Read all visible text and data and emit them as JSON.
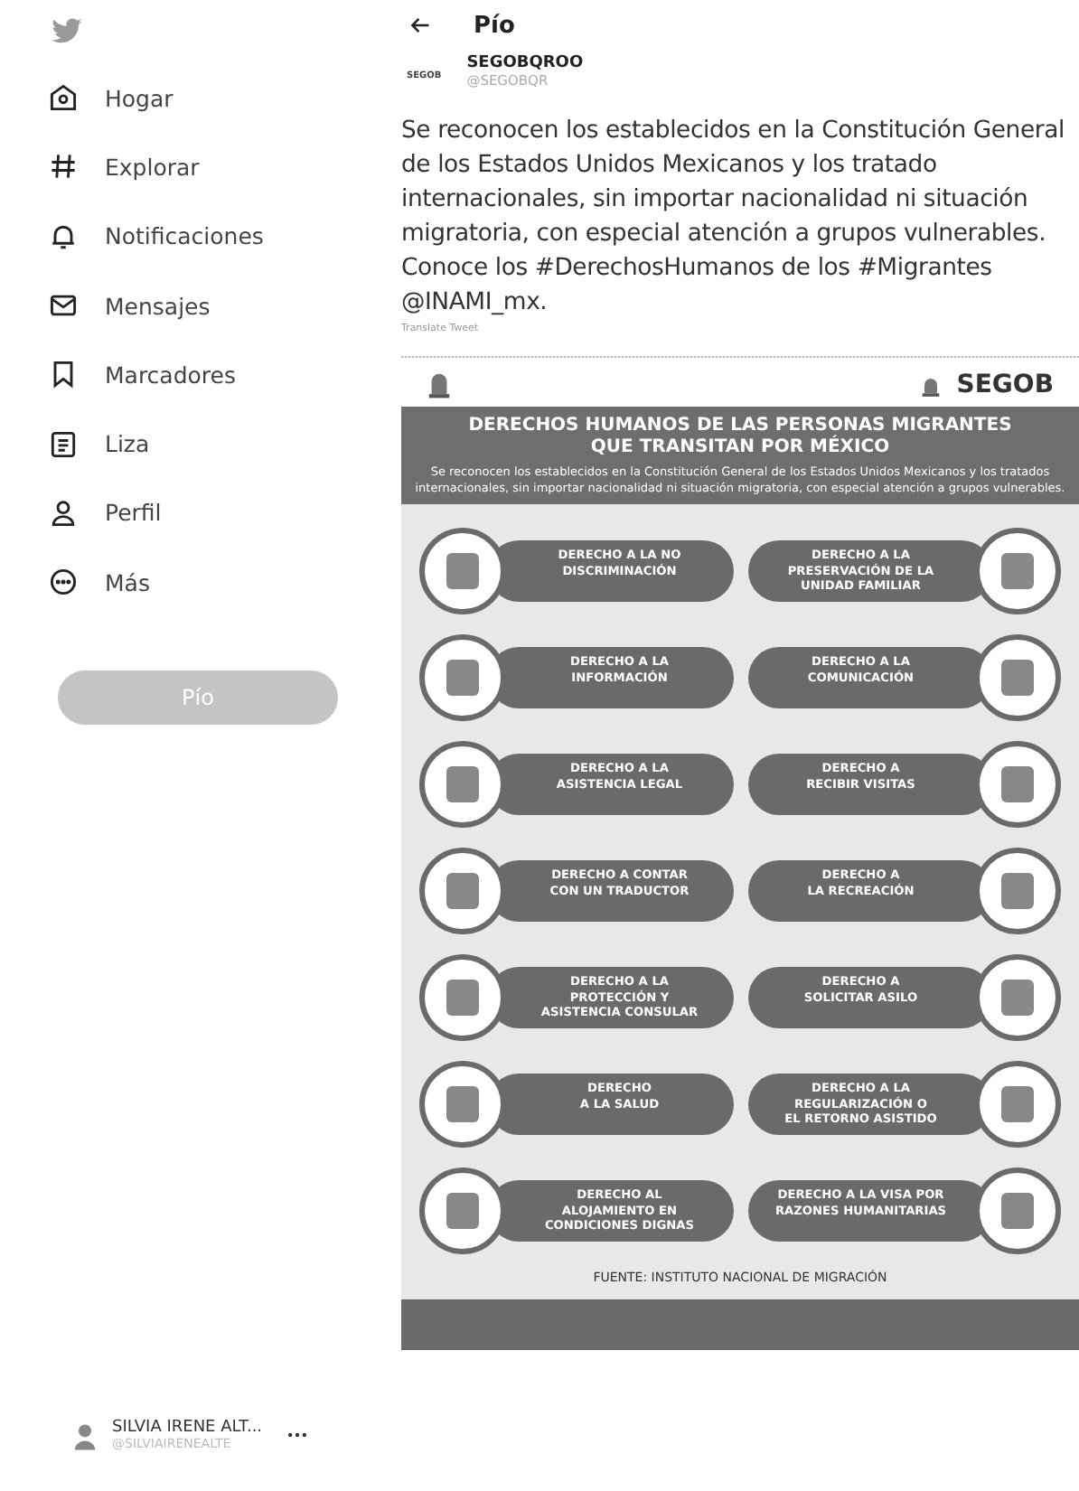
{
  "sidebar": {
    "nav": [
      {
        "label": "Hogar"
      },
      {
        "label": "Explorar"
      },
      {
        "label": "Notificaciones"
      },
      {
        "label": "Mensajes"
      },
      {
        "label": "Marcadores"
      },
      {
        "label": "Liza"
      },
      {
        "label": "Perfil"
      },
      {
        "label": "Más"
      }
    ],
    "tweet_button": "Pío",
    "account": {
      "name": "SILVIA IRENE ALT...",
      "handle": "@SILVIAIRENEALTE"
    }
  },
  "header": {
    "title": "Pío"
  },
  "tweet": {
    "author": {
      "name": "SEGOBQROO",
      "handle": "@SEGOBQR",
      "avatar_text": "SEGOB"
    },
    "text": "Se reconocen los establecidos en la Constitución General de los Estados Unidos Mexicanos y los tratado internacionales, sin importar nacionalidad ni situación migratoria, con especial atención a grupos vulnerables. Conoce los #DerechosHumanos de los #Migrantes @INAMI_mx.",
    "translate": "Translate Tweet",
    "infographic": {
      "logo": "SEGOB",
      "title": "DERECHOS HUMANOS DE LAS PERSONAS MIGRANTES\nQUE TRANSITAN POR MÉXICO",
      "subtitle": "Se reconocen los establecidos en la Constitución General de los Estados Unidos Mexicanos y los tratados internacionales, sin importar nacionalidad ni situación migratoria, con especial atención a grupos vulnerables.",
      "rights": [
        {
          "label": "DERECHO A LA NO\nDISCRIMINACIÓN"
        },
        {
          "label": "DERECHO A LA\nPRESERVACIÓN DE LA\nUNIDAD FAMILIAR"
        },
        {
          "label": "DERECHO A LA\nINFORMACIÓN"
        },
        {
          "label": "DERECHO A LA\nCOMUNICACIÓN"
        },
        {
          "label": "DERECHO A LA\nASISTENCIA LEGAL"
        },
        {
          "label": "DERECHO A\nRECIBIR VISITAS"
        },
        {
          "label": "DERECHO A CONTAR\nCON UN TRADUCTOR"
        },
        {
          "label": "DERECHO A\nLA RECREACIÓN"
        },
        {
          "label": "DERECHO A LA\nPROTECCIÓN Y\nASISTENCIA CONSULAR"
        },
        {
          "label": "DERECHO A\nSOLICITAR ASILO"
        },
        {
          "label": "DERECHO\nA LA SALUD"
        },
        {
          "label": "DERECHO A LA\nREGULARIZACIÓN O\nEL RETORNO ASISTIDO"
        },
        {
          "label": "DERECHO AL\nALOJAMIENTO EN\nCONDICIONES DIGNAS"
        },
        {
          "label": "DERECHO A LA VISA POR\nRAZONES HUMANITARIAS"
        }
      ],
      "source": "FUENTE: INSTITUTO NACIONAL DE MIGRACIÓN"
    }
  }
}
